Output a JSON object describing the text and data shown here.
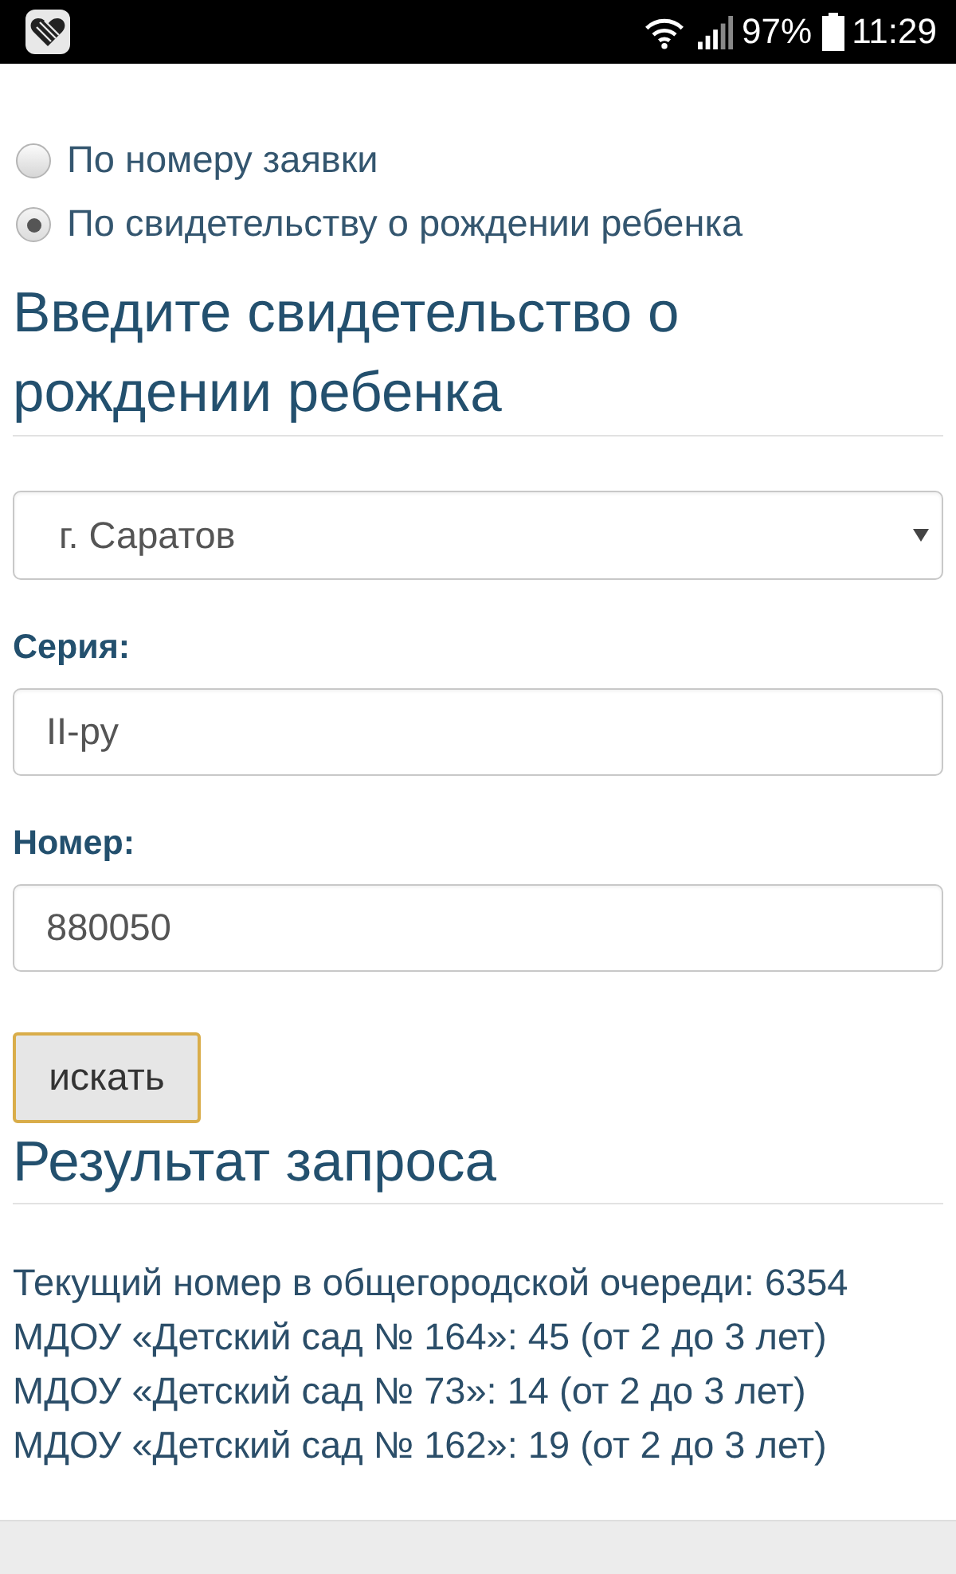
{
  "status_bar": {
    "battery_percent": "97%",
    "time": "11:29"
  },
  "search_mode": [
    {
      "label": "По номеру заявки",
      "selected": false
    },
    {
      "label": "По свидетельству о рождении ребенка",
      "selected": true
    }
  ],
  "form": {
    "heading": "Введите свидетельство о рождении ребенка",
    "city_select": {
      "value": "г. Саратов"
    },
    "fields": [
      {
        "label": "Серия:",
        "value": "II-ру"
      },
      {
        "label": "Номер:",
        "value": "880050"
      }
    ],
    "submit_button": {
      "label": "искать",
      "focused": true
    }
  },
  "result": {
    "heading": "Результат запроса",
    "lines": [
      "Текущий номер в общегородской очереди: 6354",
      "МДОУ «Детский сад № 164»: 45 (от 2 до 3 лет)",
      "МДОУ «Детский сад № 73»: 14 (от 2 до 3 лет)",
      "МДОУ «Детский сад № 162»: 19 (от 2 до 3 лет)"
    ]
  }
}
